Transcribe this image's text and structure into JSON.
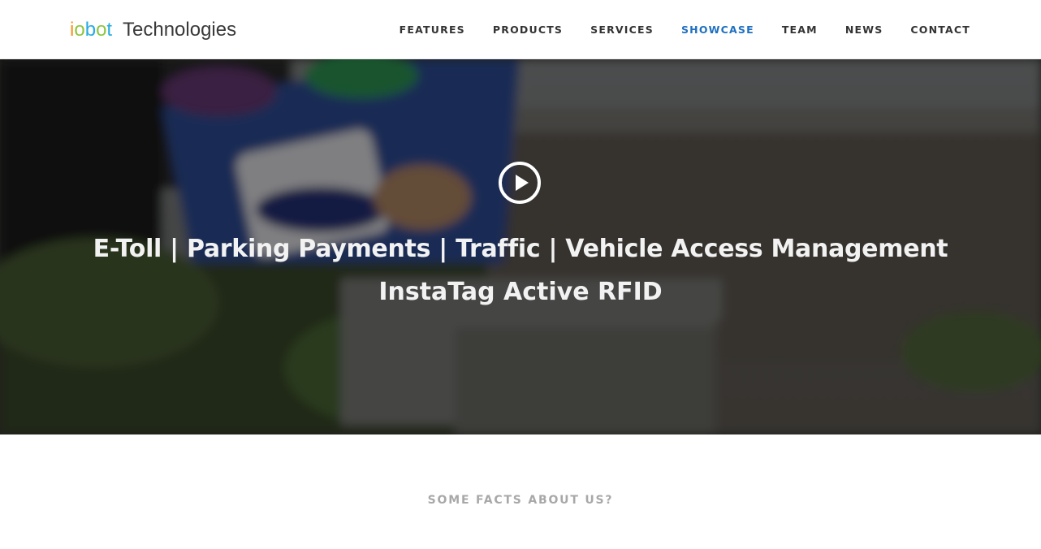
{
  "header": {
    "logo": {
      "letters": [
        {
          "char": "i",
          "color": "#f7931e"
        },
        {
          "char": "o",
          "color": "#8cc63f"
        },
        {
          "char": "b",
          "color": "#29abe2"
        },
        {
          "char": "o",
          "color": "#8cc63f"
        },
        {
          "char": "t",
          "color": "#29abe2"
        }
      ],
      "suffix": " Technologies"
    },
    "nav": [
      {
        "label": "FEATURES",
        "active": false
      },
      {
        "label": "PRODUCTS",
        "active": false
      },
      {
        "label": "SERVICES",
        "active": false
      },
      {
        "label": "SHOWCASE",
        "active": true
      },
      {
        "label": "TEAM",
        "active": false
      },
      {
        "label": "NEWS",
        "active": false
      },
      {
        "label": "CONTACT",
        "active": false
      }
    ],
    "active_color": "#1e6fc0"
  },
  "hero": {
    "play_icon": "play-circle-icon",
    "title": "E-Toll | Parking Payments | Traffic | Vehicle Access Management",
    "subtitle": "InstaTag Active RFID"
  },
  "facts": {
    "heading": "SOME FACTS ABOUT US?"
  }
}
